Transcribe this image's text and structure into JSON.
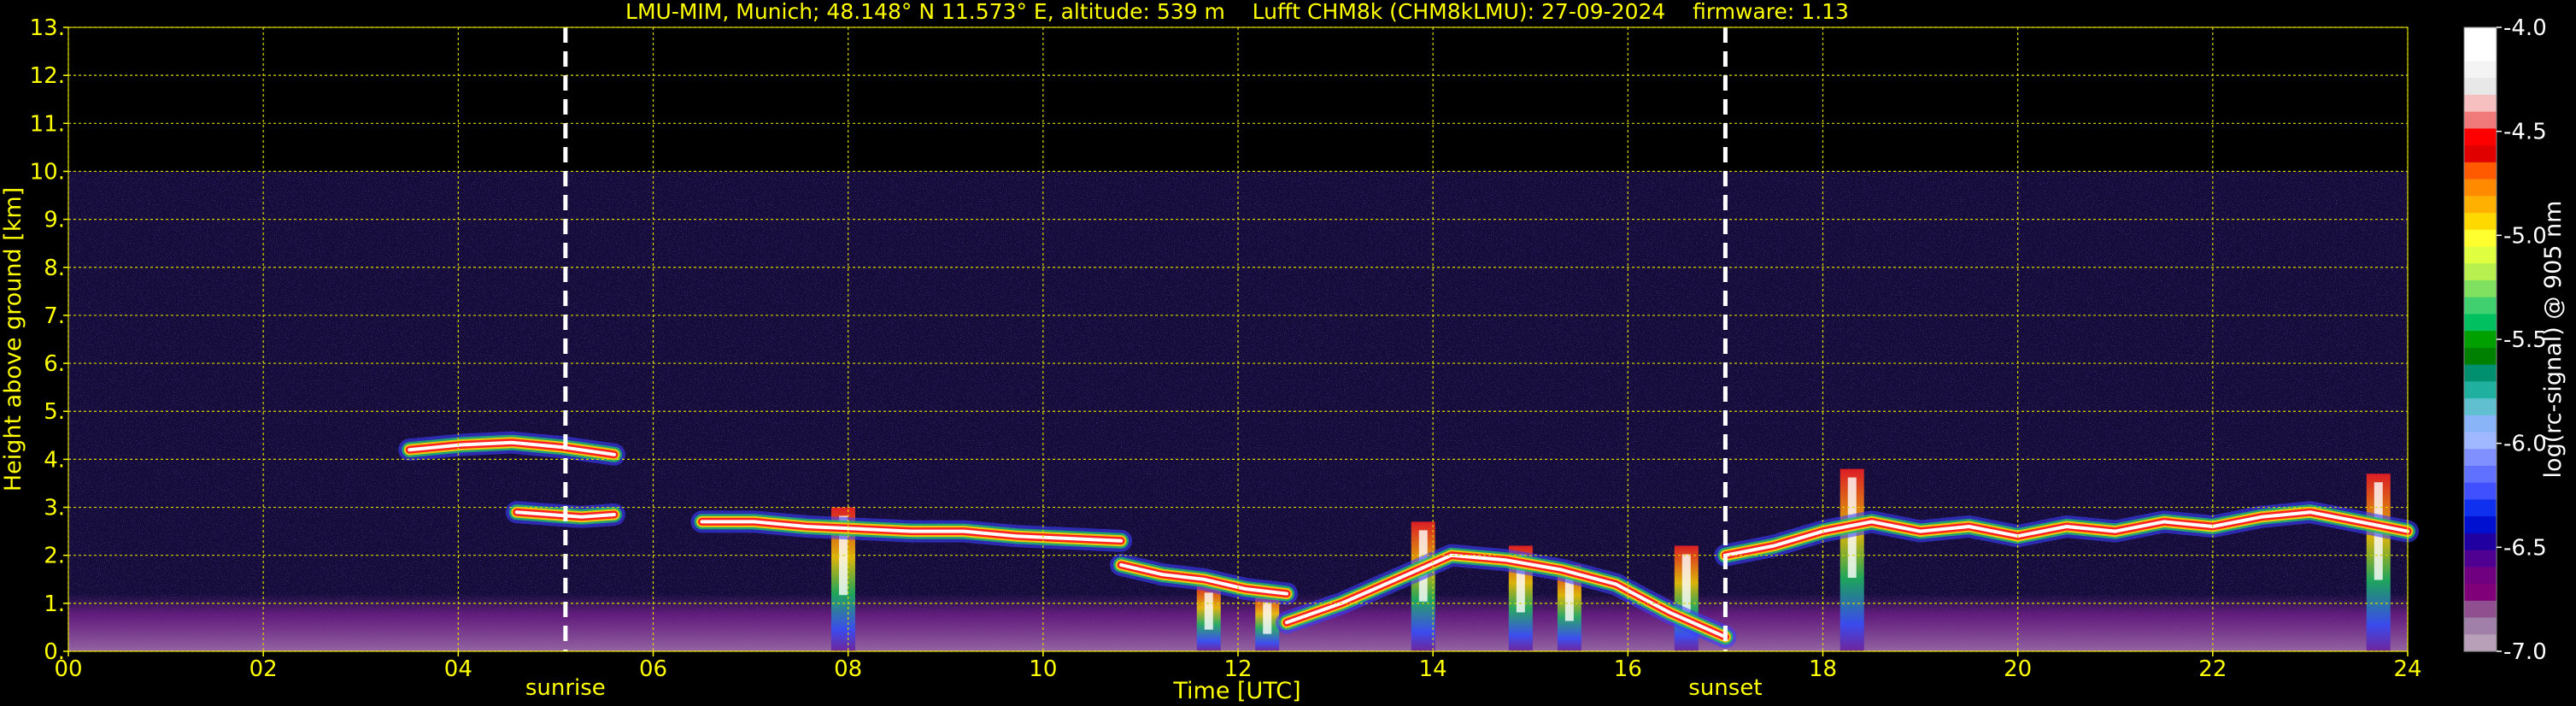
{
  "chart_data": {
    "type": "heatmap",
    "title": "LMU-MIM, Munich; 48.148° N 11.573° E, altitude: 539 m    Lufft CHM8k (CHM8kLMU): 27-09-2024    firmware: 1.13",
    "xlabel": "Time [UTC]",
    "ylabel": "Height above ground [km]",
    "xlim": [
      0,
      24
    ],
    "ylim": [
      0,
      13
    ],
    "x_ticks": [
      "00",
      "02",
      "04",
      "06",
      "08",
      "10",
      "12",
      "14",
      "16",
      "18",
      "20",
      "22",
      "24"
    ],
    "y_ticks": [
      "0.",
      "1.",
      "2.",
      "3.",
      "4.",
      "5.",
      "6.",
      "7.",
      "8.",
      "9.",
      "10.",
      "11.",
      "12.",
      "13."
    ],
    "grid": true,
    "annotations": [
      {
        "label": "sunrise",
        "x": 5.1
      },
      {
        "label": "sunset",
        "x": 17.0
      }
    ],
    "colorbar": {
      "label": "log(rc-signal) @ 905 nm",
      "range": [
        -7.0,
        -4.0
      ],
      "ticks": [
        "-4.0",
        "-4.5",
        "-5.0",
        "-5.5",
        "-6.0",
        "-6.5",
        "-7.0"
      ],
      "colors": [
        "#ffffff",
        "#ffffff",
        "#f4f4f4",
        "#e8e8e8",
        "#f6c0c0",
        "#f07a7a",
        "#ff0000",
        "#e00000",
        "#ff5a00",
        "#ff8a00",
        "#ffb000",
        "#ffd800",
        "#ffff30",
        "#e0ff40",
        "#b8f050",
        "#80e060",
        "#40d070",
        "#00c060",
        "#00a000",
        "#008000",
        "#009070",
        "#20b0a0",
        "#60c0d0",
        "#8ab4f8",
        "#a0b8ff",
        "#8090ff",
        "#6070ff",
        "#4050ff",
        "#1030f0",
        "#0010d0",
        "#2000a0",
        "#500090",
        "#700080",
        "#80007a",
        "#905090",
        "#a080a8",
        "#b8a0b8"
      ]
    },
    "features": {
      "signal_ceiling_km": 10.0,
      "noise_floor_km": 1.2,
      "cloud_layers": [
        {
          "x": [
            3.5,
            5.6
          ],
          "y": [
            4.2,
            4.3,
            4.35,
            4.25,
            4.1
          ]
        },
        {
          "x": [
            4.6,
            5.6
          ],
          "y": [
            2.9,
            2.85,
            2.8,
            2.85
          ]
        },
        {
          "x": [
            6.5,
            10.8
          ],
          "y": [
            2.7,
            2.7,
            2.6,
            2.55,
            2.5,
            2.5,
            2.4,
            2.35,
            2.3
          ]
        },
        {
          "x": [
            10.8,
            12.5
          ],
          "y": [
            1.8,
            1.6,
            1.5,
            1.3,
            1.2
          ]
        },
        {
          "x": [
            12.5,
            17.0
          ],
          "y": [
            0.6,
            1.0,
            1.5,
            2.0,
            1.9,
            1.7,
            1.4,
            0.8,
            0.3
          ]
        },
        {
          "x": [
            17.0,
            24.0
          ],
          "y": [
            2.0,
            2.2,
            2.5,
            2.7,
            2.5,
            2.6,
            2.4,
            2.6,
            2.5,
            2.7,
            2.6,
            2.8,
            2.9,
            2.7,
            2.5
          ]
        }
      ],
      "convective_columns": [
        {
          "x": 7.95,
          "top": 3.0
        },
        {
          "x": 11.7,
          "top": 1.4
        },
        {
          "x": 12.3,
          "top": 1.2
        },
        {
          "x": 13.9,
          "top": 2.7
        },
        {
          "x": 14.9,
          "top": 2.2
        },
        {
          "x": 15.4,
          "top": 1.8
        },
        {
          "x": 16.6,
          "top": 2.2
        },
        {
          "x": 18.3,
          "top": 3.8
        },
        {
          "x": 23.7,
          "top": 3.7
        }
      ]
    }
  }
}
